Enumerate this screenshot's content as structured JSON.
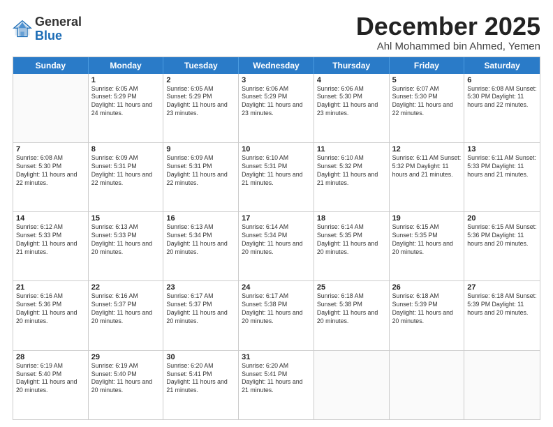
{
  "logo": {
    "general": "General",
    "blue": "Blue"
  },
  "title": "December 2025",
  "subtitle": "Ahl Mohammed bin Ahmed, Yemen",
  "days_of_week": [
    "Sunday",
    "Monday",
    "Tuesday",
    "Wednesday",
    "Thursday",
    "Friday",
    "Saturday"
  ],
  "weeks": [
    [
      {
        "day": "",
        "info": ""
      },
      {
        "day": "1",
        "info": "Sunrise: 6:05 AM\nSunset: 5:29 PM\nDaylight: 11 hours\nand 24 minutes."
      },
      {
        "day": "2",
        "info": "Sunrise: 6:05 AM\nSunset: 5:29 PM\nDaylight: 11 hours\nand 23 minutes."
      },
      {
        "day": "3",
        "info": "Sunrise: 6:06 AM\nSunset: 5:29 PM\nDaylight: 11 hours\nand 23 minutes."
      },
      {
        "day": "4",
        "info": "Sunrise: 6:06 AM\nSunset: 5:30 PM\nDaylight: 11 hours\nand 23 minutes."
      },
      {
        "day": "5",
        "info": "Sunrise: 6:07 AM\nSunset: 5:30 PM\nDaylight: 11 hours\nand 22 minutes."
      },
      {
        "day": "6",
        "info": "Sunrise: 6:08 AM\nSunset: 5:30 PM\nDaylight: 11 hours\nand 22 minutes."
      }
    ],
    [
      {
        "day": "7",
        "info": "Sunrise: 6:08 AM\nSunset: 5:30 PM\nDaylight: 11 hours\nand 22 minutes."
      },
      {
        "day": "8",
        "info": "Sunrise: 6:09 AM\nSunset: 5:31 PM\nDaylight: 11 hours\nand 22 minutes."
      },
      {
        "day": "9",
        "info": "Sunrise: 6:09 AM\nSunset: 5:31 PM\nDaylight: 11 hours\nand 22 minutes."
      },
      {
        "day": "10",
        "info": "Sunrise: 6:10 AM\nSunset: 5:31 PM\nDaylight: 11 hours\nand 21 minutes."
      },
      {
        "day": "11",
        "info": "Sunrise: 6:10 AM\nSunset: 5:32 PM\nDaylight: 11 hours\nand 21 minutes."
      },
      {
        "day": "12",
        "info": "Sunrise: 6:11 AM\nSunset: 5:32 PM\nDaylight: 11 hours\nand 21 minutes."
      },
      {
        "day": "13",
        "info": "Sunrise: 6:11 AM\nSunset: 5:33 PM\nDaylight: 11 hours\nand 21 minutes."
      }
    ],
    [
      {
        "day": "14",
        "info": "Sunrise: 6:12 AM\nSunset: 5:33 PM\nDaylight: 11 hours\nand 21 minutes."
      },
      {
        "day": "15",
        "info": "Sunrise: 6:13 AM\nSunset: 5:33 PM\nDaylight: 11 hours\nand 20 minutes."
      },
      {
        "day": "16",
        "info": "Sunrise: 6:13 AM\nSunset: 5:34 PM\nDaylight: 11 hours\nand 20 minutes."
      },
      {
        "day": "17",
        "info": "Sunrise: 6:14 AM\nSunset: 5:34 PM\nDaylight: 11 hours\nand 20 minutes."
      },
      {
        "day": "18",
        "info": "Sunrise: 6:14 AM\nSunset: 5:35 PM\nDaylight: 11 hours\nand 20 minutes."
      },
      {
        "day": "19",
        "info": "Sunrise: 6:15 AM\nSunset: 5:35 PM\nDaylight: 11 hours\nand 20 minutes."
      },
      {
        "day": "20",
        "info": "Sunrise: 6:15 AM\nSunset: 5:36 PM\nDaylight: 11 hours\nand 20 minutes."
      }
    ],
    [
      {
        "day": "21",
        "info": "Sunrise: 6:16 AM\nSunset: 5:36 PM\nDaylight: 11 hours\nand 20 minutes."
      },
      {
        "day": "22",
        "info": "Sunrise: 6:16 AM\nSunset: 5:37 PM\nDaylight: 11 hours\nand 20 minutes."
      },
      {
        "day": "23",
        "info": "Sunrise: 6:17 AM\nSunset: 5:37 PM\nDaylight: 11 hours\nand 20 minutes."
      },
      {
        "day": "24",
        "info": "Sunrise: 6:17 AM\nSunset: 5:38 PM\nDaylight: 11 hours\nand 20 minutes."
      },
      {
        "day": "25",
        "info": "Sunrise: 6:18 AM\nSunset: 5:38 PM\nDaylight: 11 hours\nand 20 minutes."
      },
      {
        "day": "26",
        "info": "Sunrise: 6:18 AM\nSunset: 5:39 PM\nDaylight: 11 hours\nand 20 minutes."
      },
      {
        "day": "27",
        "info": "Sunrise: 6:18 AM\nSunset: 5:39 PM\nDaylight: 11 hours\nand 20 minutes."
      }
    ],
    [
      {
        "day": "28",
        "info": "Sunrise: 6:19 AM\nSunset: 5:40 PM\nDaylight: 11 hours\nand 20 minutes."
      },
      {
        "day": "29",
        "info": "Sunrise: 6:19 AM\nSunset: 5:40 PM\nDaylight: 11 hours\nand 20 minutes."
      },
      {
        "day": "30",
        "info": "Sunrise: 6:20 AM\nSunset: 5:41 PM\nDaylight: 11 hours\nand 21 minutes."
      },
      {
        "day": "31",
        "info": "Sunrise: 6:20 AM\nSunset: 5:41 PM\nDaylight: 11 hours\nand 21 minutes."
      },
      {
        "day": "",
        "info": ""
      },
      {
        "day": "",
        "info": ""
      },
      {
        "day": "",
        "info": ""
      }
    ]
  ]
}
